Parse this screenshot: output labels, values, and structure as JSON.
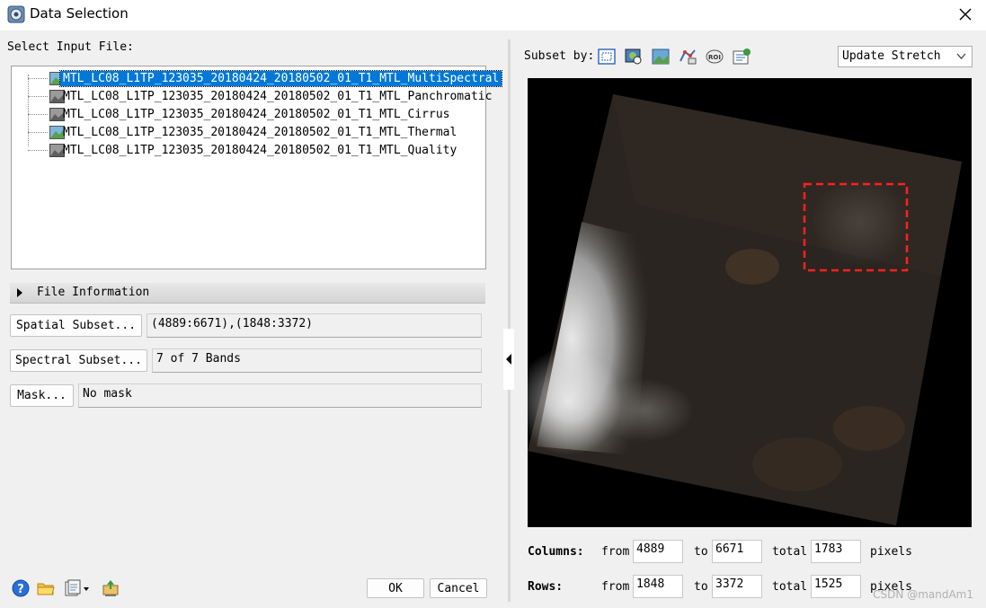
{
  "window": {
    "title": "Data Selection"
  },
  "left": {
    "select_label": "Select Input File:",
    "files": [
      {
        "name": "MTL_LC08_L1TP_123035_20180424_20180502_01_T1_MTL_MultiSpectral",
        "icon": "multispectral-raster-icon",
        "selected": true
      },
      {
        "name": "MTL_LC08_L1TP_123035_20180424_20180502_01_T1_MTL_Panchromatic",
        "icon": "grayscale-raster-icon",
        "selected": false
      },
      {
        "name": "MTL_LC08_L1TP_123035_20180424_20180502_01_T1_MTL_Cirrus",
        "icon": "grayscale-raster-icon",
        "selected": false
      },
      {
        "name": "MTL_LC08_L1TP_123035_20180424_20180502_01_T1_MTL_Thermal",
        "icon": "multispectral-raster-icon",
        "selected": false
      },
      {
        "name": "MTL_LC08_L1TP_123035_20180424_20180502_01_T1_MTL_Quality",
        "icon": "grayscale-raster-icon",
        "selected": false
      }
    ],
    "file_info_label": "File Information",
    "spatial_subset_button": "Spatial Subset...",
    "spatial_subset_value": "(4889:6671),(1848:3372)",
    "spectral_subset_button": "Spectral Subset...",
    "spectral_subset_value": "7 of 7 Bands",
    "mask_button": "Mask...",
    "mask_value": "No mask",
    "ok_button": "OK",
    "cancel_button": "Cancel"
  },
  "right": {
    "subset_by_label": "Subset by:",
    "stretch_select": "Update Stretch",
    "columns_label": "Columns:",
    "rows_label": "Rows:",
    "from_label": "from",
    "to_label": "to",
    "total_label": "total",
    "pixels_label": "pixels",
    "columns": {
      "from": "4889",
      "to": "6671",
      "total": "1783"
    },
    "rows": {
      "from": "1848",
      "to": "3372",
      "total": "1525"
    }
  },
  "watermark": "CSDN @mandAm1",
  "colors": {
    "selection": "#0078d7",
    "subset_box": "#ff2020",
    "background": "#f0f0f0"
  }
}
